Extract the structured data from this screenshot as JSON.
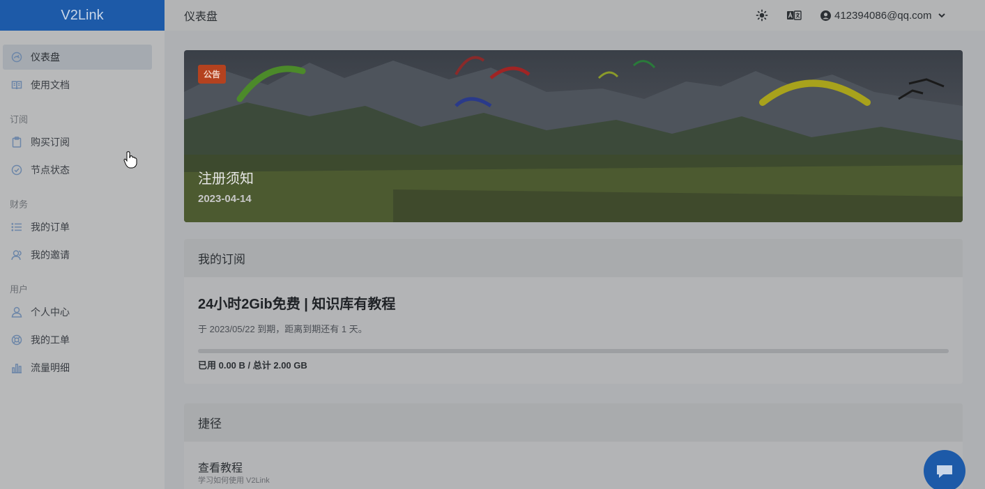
{
  "brand": "V2Link",
  "colors": {
    "accent": "#1d5aa8",
    "badge": "#b4421f"
  },
  "sidebar": {
    "items": [
      {
        "label": "仪表盘",
        "icon": "dashboard-icon",
        "active": true
      },
      {
        "label": "使用文档",
        "icon": "book-icon"
      }
    ],
    "sections": [
      {
        "label": "订阅",
        "items": [
          {
            "label": "购买订阅",
            "icon": "clipboard-icon"
          },
          {
            "label": "节点状态",
            "icon": "check-circle-icon"
          }
        ]
      },
      {
        "label": "财务",
        "items": [
          {
            "label": "我的订单",
            "icon": "list-icon"
          },
          {
            "label": "我的邀请",
            "icon": "users-icon"
          }
        ]
      },
      {
        "label": "用户",
        "items": [
          {
            "label": "个人中心",
            "icon": "user-icon"
          },
          {
            "label": "我的工单",
            "icon": "lifebuoy-icon"
          },
          {
            "label": "流量明细",
            "icon": "bar-chart-icon"
          }
        ]
      }
    ]
  },
  "header": {
    "title": "仪表盘",
    "theme_icon": "sun-icon",
    "language_icon": "translate-icon",
    "user_email": "412394086@qq.com"
  },
  "announcement": {
    "badge": "公告",
    "title": "注册须知",
    "date": "2023-04-14"
  },
  "subscription": {
    "header": "我的订阅",
    "plan_name": "24小时2Gib免费 | 知识库有教程",
    "expire_text": "于 2023/05/22 到期，距离到期还有 1 天。",
    "usage_text": "已用 0.00 B / 总计 2.00 GB",
    "usage_fraction": 0
  },
  "shortcuts": {
    "header": "捷径",
    "items": [
      {
        "title": "查看教程",
        "description": "学习如何使用 V2Link"
      }
    ]
  }
}
